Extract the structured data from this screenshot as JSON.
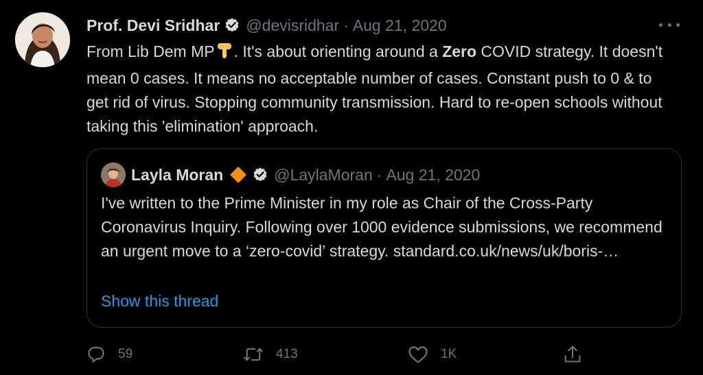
{
  "tweet": {
    "author": {
      "display_name": "Prof. Devi Sridhar",
      "handle": "@devisridhar",
      "separator": "·",
      "date": "Aug 21, 2020",
      "avatar_icon": "profile-photo",
      "verified_icon": "verified-badge-icon"
    },
    "body": {
      "part1": "From Lib Dem MP",
      "emoji": "backhand-index-pointing-down",
      "part2": ". It's about orienting around a ",
      "bold": "Zero",
      "part3": " COVID strategy. It doesn't mean 0 cases. It means no acceptable number of cases. Constant push to 0 & to get rid of virus. Stopping community transmission. Hard to re-open schools without taking this 'elimination' approach."
    },
    "more_icon": "more-options-icon"
  },
  "quoted_tweet": {
    "display_name": "Layla Moran",
    "handle": "@LaylaMoran",
    "separator": "·",
    "date": "Aug 21, 2020",
    "badge_icon": "orange-diamond-icon",
    "verified_icon": "verified-badge-icon",
    "text": "I've written to the Prime Minister in my role as Chair of the Cross-Party Coronavirus Inquiry. Following over 1000 evidence submissions, we recommend an urgent move to a ‘zero-covid’ strategy. standard.co.uk/news/uk/boris-…",
    "show_thread": "Show this thread"
  },
  "actions": {
    "reply_count": "59",
    "retweet_count": "413",
    "like_count": "1K",
    "share_icon": "share-icon"
  },
  "colors": {
    "background": "#000000",
    "text": "#d9d9d9",
    "secondary": "#6e767d",
    "link": "#1d9bf0",
    "border": "#2f3336",
    "diamond": "#f4900c"
  }
}
